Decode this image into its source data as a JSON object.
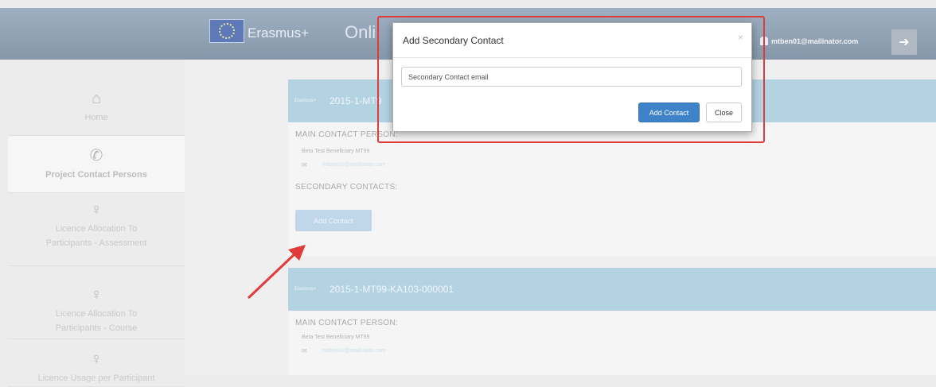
{
  "header": {
    "brand": "Erasmus+",
    "app_title": "Onli",
    "user_email": "mtben01@mailinator.com",
    "logout_icon": "logout-icon"
  },
  "sidebar": {
    "items": [
      {
        "label": "Home",
        "icon": "home-icon",
        "active": false
      },
      {
        "label": "Project Contact Persons",
        "icon": "phone-icon",
        "active": true
      },
      {
        "label": "Licence Allocation To Participants - Assessment",
        "icon": "award-icon",
        "active": false
      },
      {
        "label": "Licence Allocation To Participants - Course",
        "icon": "award-icon",
        "active": false
      },
      {
        "label": "Licence Usage per Participant",
        "icon": "award-icon",
        "active": false
      }
    ]
  },
  "projects": [
    {
      "program": "Erasmus+",
      "id": "2015-1-MT9",
      "main_contact_title": "MAIN CONTACT PERSON:",
      "contact_name": "Beta Test Beneficiary MT99",
      "contact_email": "mtben01@mailinator.com",
      "secondary_title": "SECONDARY CONTACTS:",
      "add_contact_label": "Add Contact"
    },
    {
      "program": "Erasmus+",
      "id": "2015-1-MT99-KA103-000001",
      "main_contact_title": "MAIN CONTACT PERSON:",
      "contact_name": "Beta Test Beneficiary MT99",
      "contact_email": "mtben01@mailinator.com"
    }
  ],
  "modal": {
    "title": "Add Secondary Contact",
    "close_icon": "×",
    "input_placeholder": "Secondary Contact email",
    "input_value": "",
    "add_button": "Add Contact",
    "close_button": "Close"
  },
  "colors": {
    "header": "#8f9fb3",
    "panel_header": "#b3d2e2",
    "primary_button": "#3e83c9",
    "annotation": "#e23a3a"
  }
}
